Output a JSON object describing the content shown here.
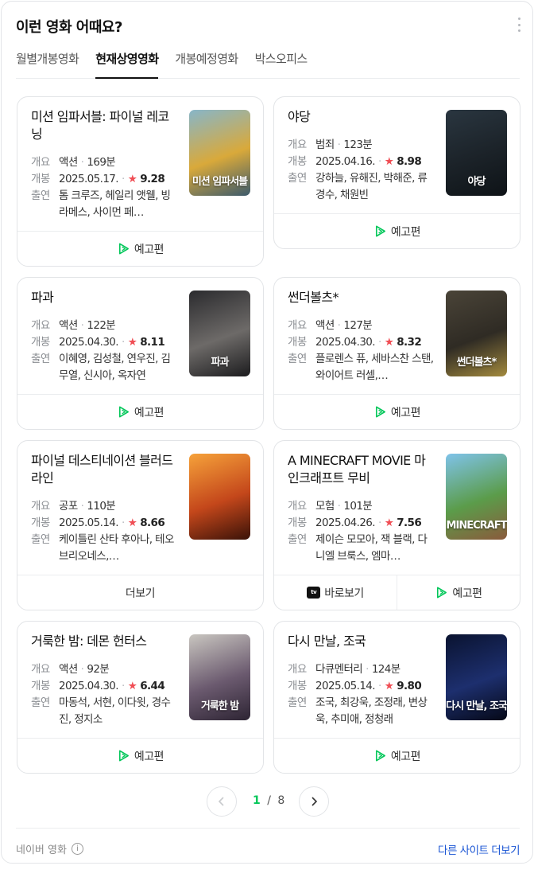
{
  "header": {
    "title": "이런 영화 어때요?"
  },
  "tabs": [
    {
      "label": "월별개봉영화"
    },
    {
      "label": "현재상영영화"
    },
    {
      "label": "개봉예정영화"
    },
    {
      "label": "박스오피스"
    }
  ],
  "active_tab": 1,
  "labels": {
    "summary": "개요",
    "release": "개봉",
    "cast": "출연",
    "star": "★"
  },
  "movies": [
    {
      "title": "미션 임파서블: 파이널 레코닝",
      "genre": "액션",
      "runtime": "169분",
      "date": "2025.05.17.",
      "rating": "9.28",
      "cast": "톰 크루즈, 헤일리 앳웰, 빙 라메스, 사이먼 페…",
      "poster_text": "미션 임파서블",
      "poster_colors": [
        "#87b6c9",
        "#d9a93a",
        "#3c5a6c"
      ],
      "actions": [
        {
          "label": "예고편",
          "icon": "play-icon"
        }
      ]
    },
    {
      "title": "야당",
      "genre": "범죄",
      "runtime": "123분",
      "date": "2025.04.16.",
      "rating": "8.98",
      "cast": "강하늘, 유해진, 박해준, 류경수, 채원빈",
      "poster_text": "야당",
      "poster_colors": [
        "#2a3640",
        "#1b2228",
        "#0e1317"
      ],
      "actions": [
        {
          "label": "예고편",
          "icon": "play-icon"
        }
      ]
    },
    {
      "title": "파과",
      "genre": "액션",
      "runtime": "122분",
      "date": "2025.04.30.",
      "rating": "8.11",
      "cast": "이혜영, 김성철, 연우진, 김무열, 신시아, 옥자연",
      "poster_text": "파과",
      "poster_colors": [
        "#2b2b2e",
        "#6d6a68",
        "#1c1c1e"
      ],
      "actions": [
        {
          "label": "예고편",
          "icon": "play-icon"
        }
      ]
    },
    {
      "title": "썬더볼츠*",
      "genre": "액션",
      "runtime": "127분",
      "date": "2025.04.30.",
      "rating": "8.32",
      "cast": "플로렌스 퓨, 세바스찬 스탠, 와이어트 러셀,…",
      "poster_text": "썬더볼츠*",
      "poster_colors": [
        "#4a4438",
        "#2f2b24",
        "#a38a3e"
      ],
      "actions": [
        {
          "label": "예고편",
          "icon": "play-icon"
        }
      ]
    },
    {
      "title": "파이널 데스티네이션 블러드라인",
      "genre": "공포",
      "runtime": "110분",
      "date": "2025.05.14.",
      "rating": "8.66",
      "cast": "케이틀린 산타 후아나, 테오 브리오네스,…",
      "poster_text": "",
      "poster_colors": [
        "#f6a23a",
        "#c4471b",
        "#3a1208"
      ],
      "actions": [
        {
          "label": "더보기",
          "icon": ""
        }
      ]
    },
    {
      "title": "A MINECRAFT MOVIE 마인크래프트 무비",
      "genre": "모험",
      "runtime": "101분",
      "date": "2025.04.26.",
      "rating": "7.56",
      "cast": "제이슨 모모아, 잭 블랙, 다니엘 브룩스, 엠마…",
      "poster_text": "MINECRAFT",
      "poster_colors": [
        "#7fc3ea",
        "#5b9c4a",
        "#8a5a3c"
      ],
      "actions": [
        {
          "label": "바로보기",
          "icon": "appletv-icon"
        },
        {
          "label": "예고편",
          "icon": "play-icon"
        }
      ]
    },
    {
      "title": "거룩한 밤: 데몬 헌터스",
      "genre": "액션",
      "runtime": "92분",
      "date": "2025.04.30.",
      "rating": "6.44",
      "cast": "마동석, 서현, 이다윗, 경수진, 정지소",
      "poster_text": "거룩한 밤",
      "poster_colors": [
        "#c9c6c0",
        "#6b5a6f",
        "#2d2433"
      ],
      "actions": [
        {
          "label": "예고편",
          "icon": "play-icon"
        }
      ]
    },
    {
      "title": "다시 만날, 조국",
      "genre": "다큐멘터리",
      "runtime": "124분",
      "date": "2025.05.14.",
      "rating": "9.80",
      "cast": "조국, 최강욱, 조정래, 변상욱, 추미애, 정청래",
      "poster_text": "다시 만날, 조국",
      "poster_colors": [
        "#0a1330",
        "#1d2f6e",
        "#050816"
      ],
      "actions": [
        {
          "label": "예고편",
          "icon": "play-icon"
        }
      ]
    }
  ],
  "pagination": {
    "current": "1",
    "total": "8",
    "separator": "/"
  },
  "footer": {
    "source": "네이버 영화",
    "info_icon": "i",
    "more_sites": "다른 사이트 더보기"
  },
  "colors": {
    "accent_green": "#03c75a",
    "star_red": "#f04e55",
    "link_blue": "#1a55d4"
  }
}
